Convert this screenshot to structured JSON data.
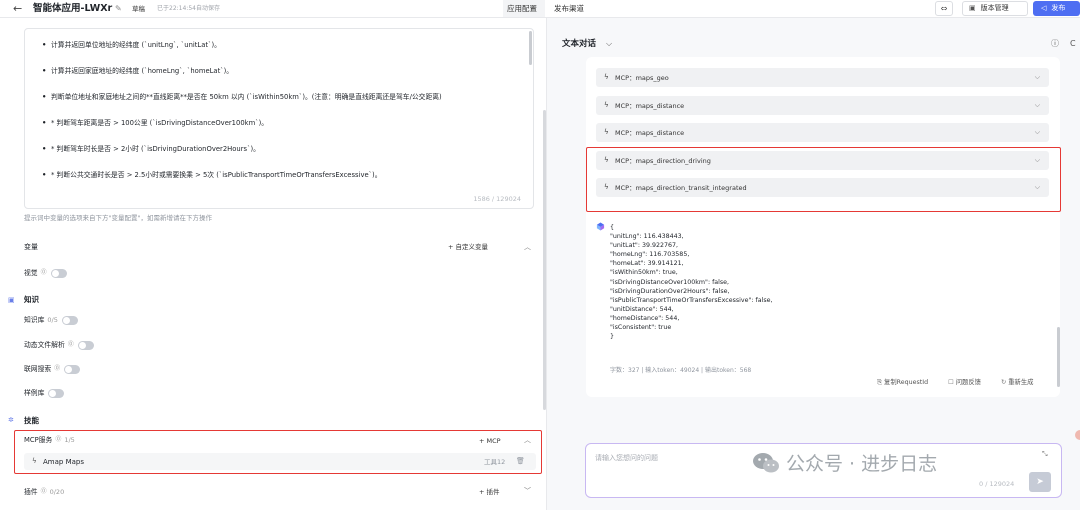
{
  "header": {
    "back_icon": "arrow-left-icon",
    "app_title": "智能体应用-LWXr",
    "draft_label": "草稿",
    "save_status": "已于22:14:54自动保存",
    "tabs": [
      {
        "label": "应用配置",
        "active": true
      },
      {
        "label": "发布渠道",
        "active": false
      }
    ],
    "version_label": "版本管理",
    "publish_label": "发布",
    "publish_color": "#4e6ef2"
  },
  "prompt": {
    "lines": [
      "计算并返回单位地址的经纬度 (`unitLng`, `unitLat`)。",
      "计算并返回家庭地址的经纬度 (`homeLng`, `homeLat`)。",
      "判断单位地址和家庭地址之间的**直线距离**是否在 50km 以内 (`isWithin50km`)。(注意：明确是直线距离还是驾车/公交距离)",
      "* 判断驾车距离是否 > 100公里 (`isDrivingDistanceOver100km`)。",
      "* 判断驾车时长是否 > 2小时 (`isDrivingDurationOver2Hours`)。",
      "* 判断公共交通时长是否 > 2.5小时或需要换乘 > 5次 (`isPublicTransportTimeOrTransfersExcessive`)。"
    ],
    "counter": "1586 / 129024",
    "hint": "提示词中变量的选项来自下方\"变量配置\"，如需新增请在下方操作"
  },
  "config": {
    "variables": {
      "title": "变量",
      "add_label": "+ 自定义变量"
    },
    "vision": {
      "label": "视觉"
    },
    "knowledge": {
      "title": "知识"
    },
    "knowledge_base": {
      "label": "知识库",
      "count": "0/5"
    },
    "dynamic_file": {
      "label": "动态文件解析"
    },
    "web_search": {
      "label": "联网搜索"
    },
    "examples": {
      "label": "样例库"
    },
    "skills": {
      "title": "技能"
    },
    "mcp": {
      "title": "MCP服务",
      "count": "1/5",
      "add_label": "+ MCP",
      "item_name": "Amap Maps",
      "item_tools": "工具12"
    },
    "plugins": {
      "title": "插件",
      "count": "0/20",
      "add_label": "+ 插件"
    }
  },
  "chat": {
    "title": "文本对话",
    "tool_calls": [
      "MCP：maps_geo",
      "MCP：maps_distance",
      "MCP：maps_distance",
      "MCP：maps_direction_driving",
      "MCP：maps_direction_transit_integrated"
    ],
    "json_lines": [
      "{",
      "\"unitLng\": 116.438443,",
      "\"unitLat\": 39.922767,",
      "\"homeLng\": 116.703585,",
      "\"homeLat\": 39.914121,",
      "\"isWithin50km\": true,",
      "\"isDrivingDistanceOver100km\": false,",
      "\"isDrivingDurationOver2Hours\": false,",
      "\"isPublicTransportTimeOrTransfersExcessive\": false,",
      "\"unitDistance\": 544,",
      "\"homeDistance\": 544,",
      "\"isConsistent\": true",
      "}"
    ],
    "stats": "字数：327 | 输入token：49024 | 输出token：568",
    "actions": [
      "复制RequestId",
      "问题反馈",
      "重新生成"
    ],
    "input_placeholder": "请输入您想问的问题",
    "input_counter": "0 / 129024"
  },
  "watermark": "公众号 · 进步日志",
  "colors": {
    "highlight_border": "#e53935",
    "accent": "#4e6ef2"
  }
}
